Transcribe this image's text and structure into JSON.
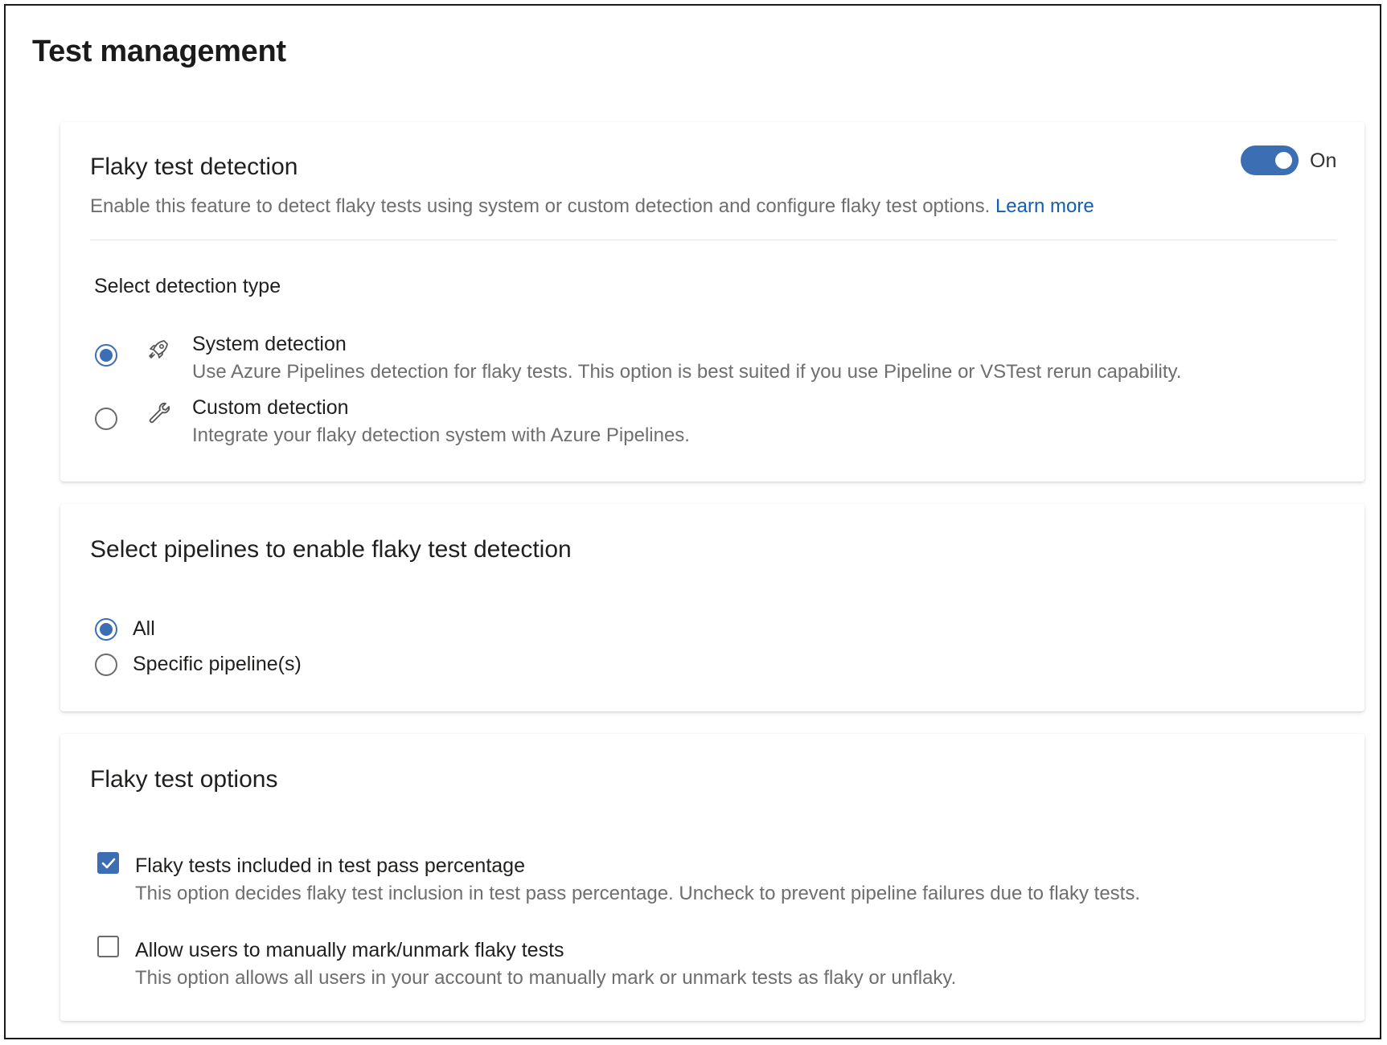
{
  "page": {
    "title": "Test management"
  },
  "flaky_detection": {
    "title": "Flaky test detection",
    "description": "Enable this feature to detect flaky tests using system or custom detection and configure flaky test options.",
    "learn_more": "Learn more",
    "toggle": {
      "state": true,
      "label": "On"
    },
    "detection_type_label": "Select detection type",
    "options": [
      {
        "title": "System detection",
        "description": "Use Azure Pipelines detection for flaky tests. This option is best suited if you use Pipeline or VSTest rerun capability.",
        "icon": "rocket-icon",
        "selected": true
      },
      {
        "title": "Custom detection",
        "description": "Integrate your flaky detection system with Azure Pipelines.",
        "icon": "wrench-icon",
        "selected": false
      }
    ]
  },
  "pipelines": {
    "title": "Select pipelines to enable flaky test detection",
    "options": [
      {
        "label": "All",
        "selected": true
      },
      {
        "label": "Specific pipeline(s)",
        "selected": false
      }
    ]
  },
  "flaky_options": {
    "title": "Flaky test options",
    "options": [
      {
        "title": "Flaky tests included in test pass percentage",
        "description": "This option decides flaky test inclusion in test pass percentage. Uncheck to prevent pipeline failures due to flaky tests.",
        "checked": true
      },
      {
        "title": "Allow users to manually mark/unmark flaky tests",
        "description": "This option allows all users in your account to manually mark or unmark tests as flaky or unflaky.",
        "checked": false
      }
    ]
  },
  "colors": {
    "accent": "#3c6eb4",
    "link": "#0f5fb4",
    "secondary_text": "#6e6e6e"
  }
}
